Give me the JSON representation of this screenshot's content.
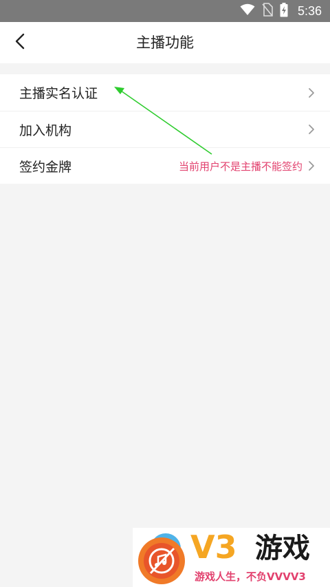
{
  "status_bar": {
    "time": "5:36",
    "icons": [
      "wifi-icon",
      "no-sim-icon",
      "battery-charging-icon"
    ]
  },
  "header": {
    "title": "主播功能",
    "back_icon": "chevron-left-icon"
  },
  "menu": {
    "items": [
      {
        "label": "主播实名认证",
        "note": ""
      },
      {
        "label": "加入机构",
        "note": ""
      },
      {
        "label": "签约金牌",
        "note": "当前用户不是主播不能签约"
      }
    ]
  },
  "annotation": {
    "color": "#2ecc2e"
  },
  "watermark": {
    "brand": "V3",
    "brand_cn": "游戏",
    "slogan": "游戏人生，不负VVVV3",
    "colors": {
      "brand": "#f5a623",
      "slogan": "#e2416e"
    }
  },
  "colors": {
    "status_bar": "#7a7a7a",
    "note": "#e2416e",
    "background": "#f4f4f4"
  }
}
